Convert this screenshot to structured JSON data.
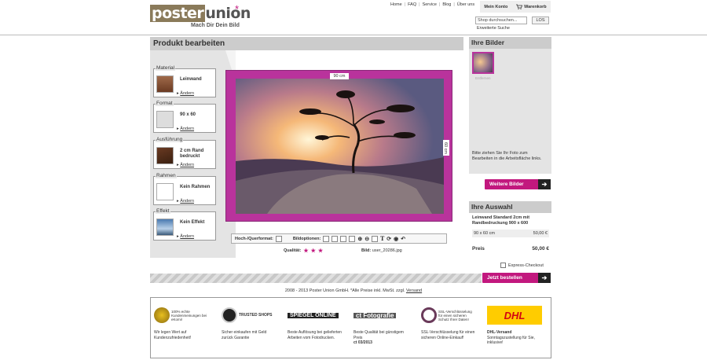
{
  "header": {
    "logo_a": "poster",
    "logo_b": "union",
    "logo_star": "*",
    "tagline": "Mach Dir Dein Bild",
    "nav": [
      "Home",
      "FAQ",
      "Service",
      "Blog",
      "Über uns"
    ],
    "account_label": "Mein Konto",
    "cart_label": "Warenkorb",
    "search_placeholder": "Shop durchsuchen...",
    "search_button": "LOS",
    "advanced_search": "Erweiterte Suche"
  },
  "editor": {
    "title": "Produkt bearbeiten",
    "options": [
      {
        "label": "Material",
        "value": "Leinwand",
        "change": "Ändern"
      },
      {
        "label": "Format",
        "value": "90 x 60",
        "change": "Ändern"
      },
      {
        "label": "Ausführung",
        "value": "2 cm Rand bedruckt",
        "change": "Ändern"
      },
      {
        "label": "Rahmen",
        "value": "Kein Rahmen",
        "change": "Ändern"
      },
      {
        "label": "Effekt",
        "value": "Kein Effekt",
        "change": "Ändern"
      }
    ],
    "dim_width": "90 cm",
    "dim_height": "60 cm",
    "toolbar": {
      "orientation_label": "Hoch-/Querformat:",
      "image_options_label": "Bildoptionen:"
    },
    "quality_label": "Qualität:",
    "quality_stars": 3,
    "image_label": "Bild:",
    "image_name": "user_20286.jpg"
  },
  "your_images": {
    "title": "Ihre Bilder",
    "thumb_caption": "Entfernen",
    "hint": "Bitte ziehen Sie Ihr Foto zum Bearbeiten in die Arbeitsfläche links.",
    "more_button": "Weitere Bilder"
  },
  "selection": {
    "title": "Ihre Auswahl",
    "product": "Leinwand Standard 2cm mit Randbedruckung 900 x 600",
    "size": "90 x 60 cm",
    "size_price": "50,00 €",
    "price_label": "Preis",
    "price": "50,00 €",
    "express_label": "Express-Checkout",
    "order_button": "Jetzt bestellen"
  },
  "footer": {
    "copyright_prefix": "2008 - 2013 Poster Union GmbH. *Alle Preise inkl. MwSt. zzgl. ",
    "shipping_link": "Versand",
    "trust": [
      {
        "logo": "100% echte Kundenmeinungen bei eKomi!",
        "text": "Wir legen Wert auf Kundenzufriedenheit!"
      },
      {
        "logo": "TRUSTED SHOPS",
        "text": "Sicher einkaufen mit Geld zurück Garantie"
      },
      {
        "logo": "SPIEGEL ONLINE",
        "text": "Beste Auflösung bei gelieferten Arbeiten vom Fotodrucken."
      },
      {
        "logo": "ct Fotografie",
        "text": "Beste Qualität bei günstigem Preis",
        "extra": "ct 03/2013"
      },
      {
        "logo": "SSL-Verschlüsselung für einen sicheren Schutz Ihrer Daten!",
        "text": "SSL-Verschlüsselung für einen sicheren Online-Einkauf!"
      },
      {
        "logo": "DHL",
        "text": "DHL-Versand",
        "extra": "Sonntagszustellung für Sie, inklusive!"
      }
    ]
  },
  "colors": {
    "accent": "#c2187e",
    "frame": "#b9339c",
    "logo_bg": "#8a7a5a"
  }
}
